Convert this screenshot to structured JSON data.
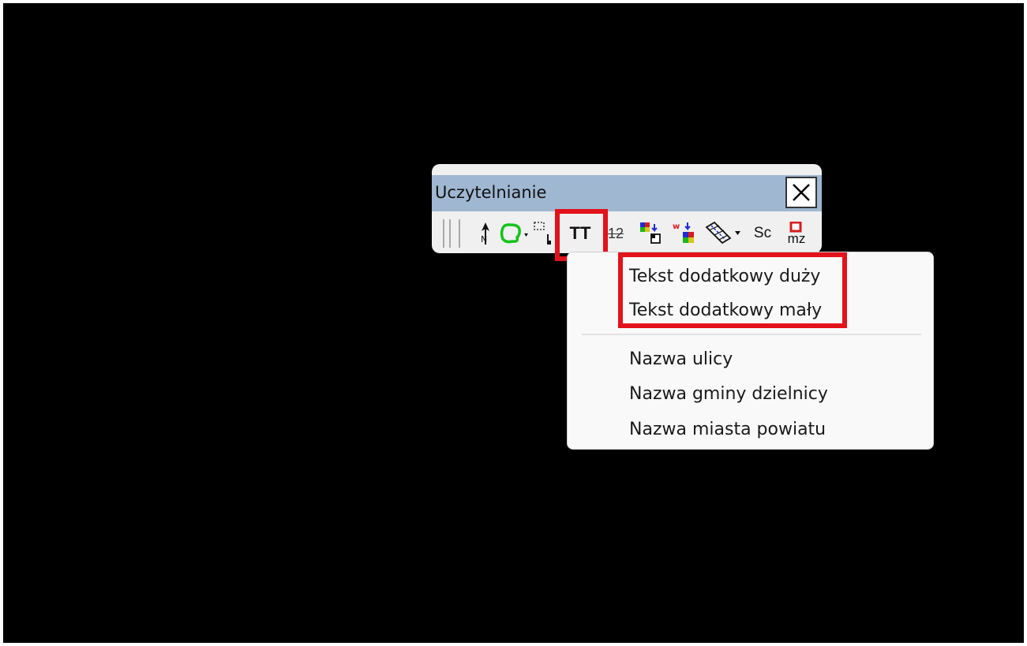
{
  "toolbar": {
    "title": "Uczytelnianie",
    "close_label": "X",
    "tools": {
      "north_arrow": "north-arrow-icon",
      "region_outline": "region-outline-icon",
      "selection_dots": "selection-dots-icon",
      "text_tt_label": "TT",
      "text_12_label": "12",
      "layers_a": "layers-icon",
      "layers_w": "layers-w-icon",
      "hatch": "hatch-icon",
      "sc_label": "Sc",
      "mz_label": "mz"
    }
  },
  "menu": {
    "items": [
      {
        "label": "Tekst dodatkowy duży"
      },
      {
        "label": "Tekst dodatkowy mały"
      },
      {
        "label": "Nazwa ulicy"
      },
      {
        "label": "Nazwa gminy dzielnicy"
      },
      {
        "label": "Nazwa miasta powiatu"
      }
    ]
  },
  "colors": {
    "background": "#000000",
    "titlebar": "#9fb7d1",
    "highlight": "#e3121b",
    "menu_bg": "#f9f9f9"
  }
}
